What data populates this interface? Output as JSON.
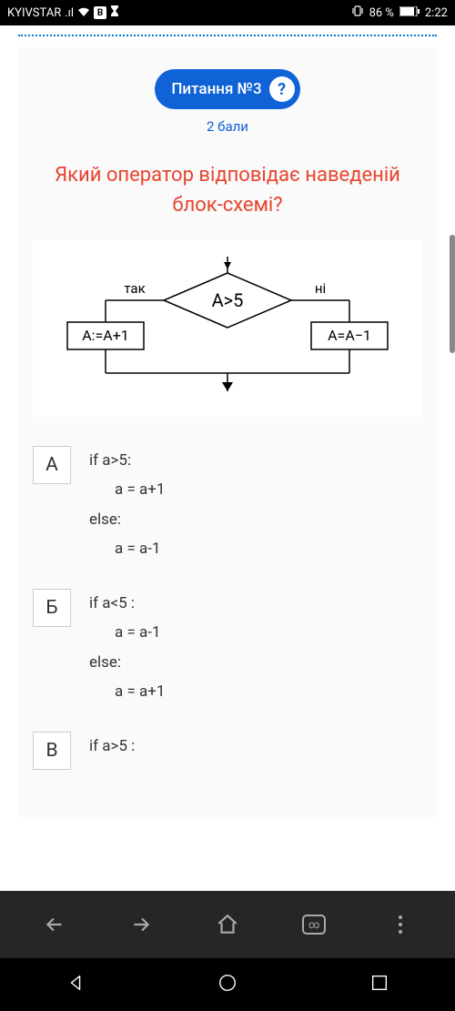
{
  "status_bar": {
    "carrier": "KYIVSTAR",
    "b_badge": "B",
    "battery": "86 %",
    "time": "2:22"
  },
  "question": {
    "badge_label": "Питання №3",
    "help_mark": "?",
    "points": "2 бали",
    "text": "Який оператор відповідає наведеній блок-схемі?"
  },
  "flowchart": {
    "condition": "A>5",
    "yes_label": "так",
    "no_label": "ні",
    "yes_action": "A:=A+1",
    "no_action": "A=A−1"
  },
  "answers": [
    {
      "letter": "А",
      "lines": [
        {
          "text": "if a>5:",
          "indent": false
        },
        {
          "text": "a = a+1",
          "indent": true
        },
        {
          "text": "else:",
          "indent": false
        },
        {
          "text": "a = a-1",
          "indent": true
        }
      ]
    },
    {
      "letter": "Б",
      "lines": [
        {
          "text": "if a<5 :",
          "indent": false
        },
        {
          "text": "a = a-1",
          "indent": true
        },
        {
          "text": "else:",
          "indent": false
        },
        {
          "text": "a = a+1",
          "indent": true
        }
      ]
    },
    {
      "letter": "В",
      "lines": [
        {
          "text": "if a>5 :",
          "indent": false
        }
      ]
    }
  ],
  "browser": {
    "tabs_count": "∞"
  }
}
